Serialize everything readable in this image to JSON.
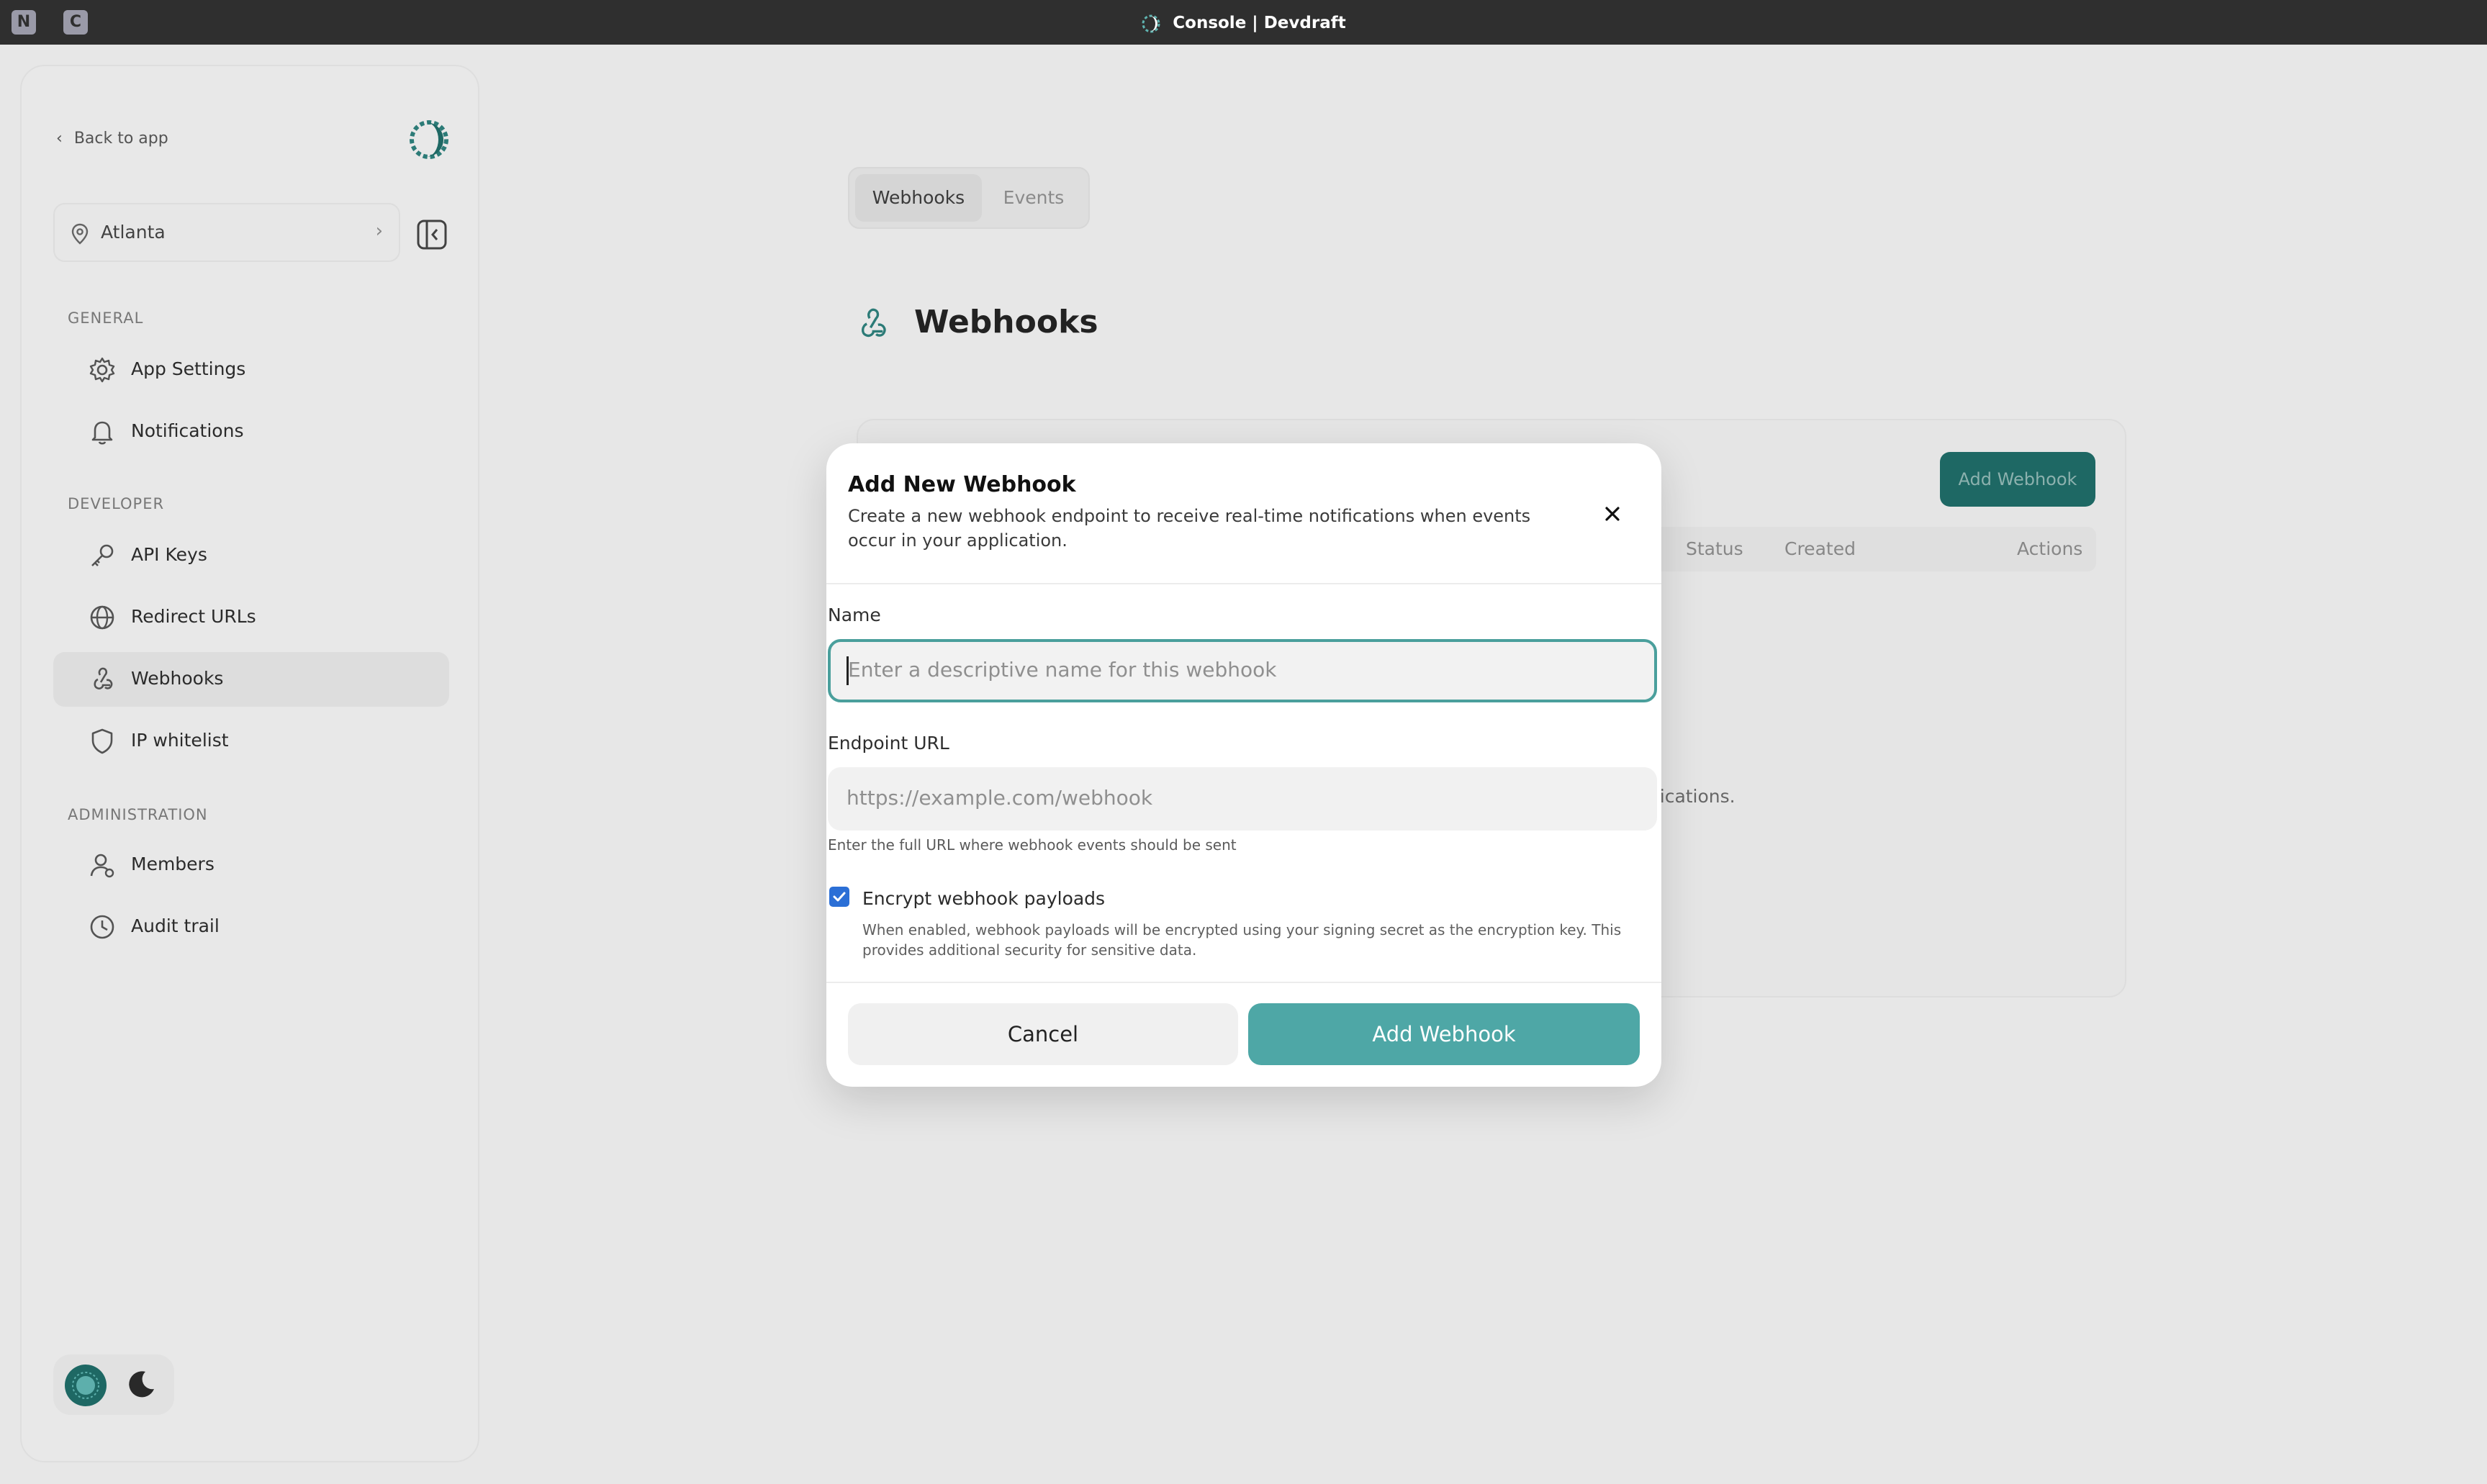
{
  "titlebar": {
    "badge_n": "N",
    "badge_c": "C",
    "title": "Console | Devdraft"
  },
  "sidebar": {
    "back_label": "Back to app",
    "location": "Atlanta",
    "sections": {
      "general": "GENERAL",
      "developer": "DEVELOPER",
      "administration": "ADMINISTRATION"
    },
    "items": [
      {
        "label": "App Settings",
        "icon": "gear-icon"
      },
      {
        "label": "Notifications",
        "icon": "bell-icon"
      },
      {
        "label": "API Keys",
        "icon": "key-icon"
      },
      {
        "label": "Redirect URLs",
        "icon": "globe-icon"
      },
      {
        "label": "Webhooks",
        "icon": "webhook-icon",
        "active": true
      },
      {
        "label": "IP whitelist",
        "icon": "shield-icon"
      },
      {
        "label": "Members",
        "icon": "user-icon"
      },
      {
        "label": "Audit trail",
        "icon": "clock-icon"
      }
    ]
  },
  "main": {
    "tabs": [
      "Webhooks",
      "Events"
    ],
    "page_title": "Webhooks",
    "add_button": "Add Webhook",
    "table_headers": [
      "Status",
      "Created",
      "Actions"
    ],
    "empty_hint_fragment": "ifications."
  },
  "modal": {
    "title": "Add New Webhook",
    "description": "Create a new webhook endpoint to receive real-time notifications when events occur in your application.",
    "name_label": "Name",
    "name_placeholder": "Enter a descriptive name for this webhook",
    "url_label": "Endpoint URL",
    "url_placeholder": "https://example.com/webhook",
    "url_hint": "Enter the full URL where webhook events should be sent",
    "encrypt_label": "Encrypt webhook payloads",
    "encrypt_checked": true,
    "encrypt_description": "When enabled, webhook payloads will be encrypted using your signing secret as the encryption key. This provides additional security for sensitive data.",
    "cancel_label": "Cancel",
    "submit_label": "Add Webhook"
  },
  "colors": {
    "accent": "#4ea7a6",
    "accent_dark": "#1f6b66",
    "checkbox": "#2b6fd6"
  }
}
